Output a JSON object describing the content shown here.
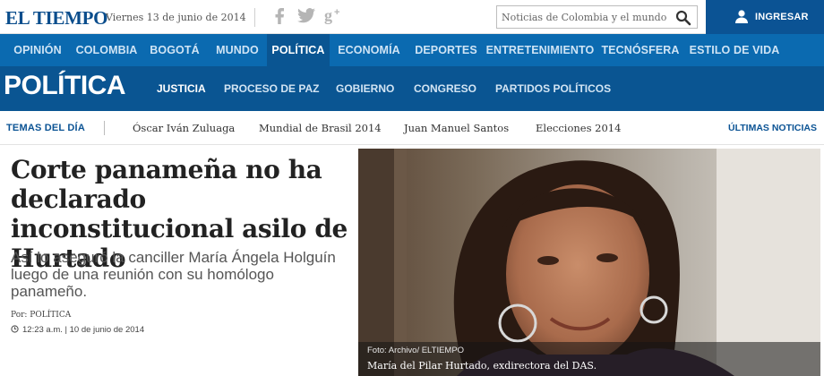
{
  "header": {
    "logo": "EL TIEMPO",
    "date": "Viernes 13 de junio de 2014",
    "social": [
      {
        "icon": "facebook-icon",
        "glyph": "f"
      },
      {
        "icon": "twitter-icon",
        "glyph": "t"
      },
      {
        "icon": "google-plus-icon",
        "glyph": "8+"
      }
    ],
    "search": {
      "placeholder": "Noticias de Colombia y el mundo",
      "value": ""
    },
    "login_label": "INGRESAR"
  },
  "main_nav": {
    "items": [
      "OPINIÓN",
      "COLOMBIA",
      "BOGOTÁ",
      "MUNDO",
      "POLÍTICA",
      "ECONOMÍA",
      "DEPORTES",
      "ENTRETENIMIENTO",
      "TECNÓSFERA",
      "ESTILO DE VIDA"
    ],
    "active": "POLÍTICA"
  },
  "section": {
    "title": "POLÍTICA",
    "subnav": [
      "JUSTICIA",
      "PROCESO DE PAZ",
      "GOBIERNO",
      "CONGRESO",
      "PARTIDOS POLÍTICOS"
    ],
    "active": "JUSTICIA"
  },
  "temas": {
    "label": "TEMAS DEL DÍA",
    "items": [
      "Óscar Iván Zuluaga",
      "Mundial de Brasil 2014",
      "Juan Manuel Santos",
      "Elecciones 2014"
    ],
    "ultimas": "ÚLTIMAS NOTICIAS"
  },
  "article": {
    "headline": "Corte panameña no ha declarado inconstitucional asilo de Hurtado",
    "deck": "Así lo aseguró la canciller María Ángela Holguín luego de una reunión con su homólogo panameño.",
    "byline": "Por: POLÍTICA",
    "timestamp": "12:23 a.m. | 10 de junio de 2014"
  },
  "photo": {
    "credit": "Foto: Archivo/ ELTIEMPO",
    "caption": "María del Pilar Hurtado, exdirectora del DAS."
  },
  "colors": {
    "brand_blue": "#0b6ab0",
    "section_blue": "#0a5592",
    "logo_blue": "#0a4d8c"
  }
}
